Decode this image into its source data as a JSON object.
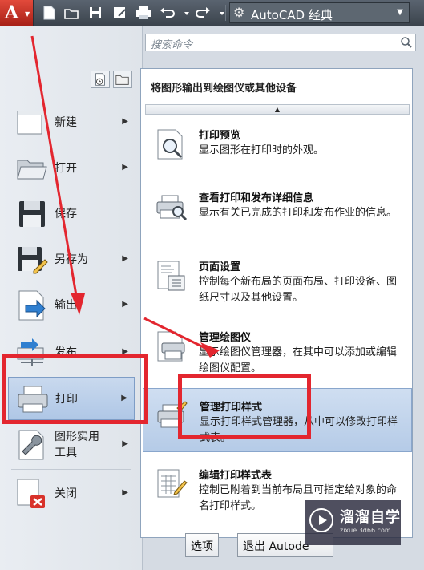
{
  "toolbar": {
    "workspace_label": "AutoCAD 经典"
  },
  "search": {
    "placeholder": "搜索命令"
  },
  "nav": {
    "items": [
      {
        "label": "新建",
        "icon": "new-document-icon"
      },
      {
        "label": "打开",
        "icon": "folder-open-icon"
      },
      {
        "label": "保存",
        "icon": "floppy-disk-icon"
      },
      {
        "label": "另存为",
        "icon": "save-as-icon"
      },
      {
        "label": "输出",
        "icon": "export-icon"
      },
      {
        "label": "发布",
        "icon": "publish-icon"
      },
      {
        "label": "打印",
        "icon": "printer-icon"
      },
      {
        "label": "图形实用工具",
        "label_line1": "图形实用",
        "label_line2": "工具",
        "icon": "wrench-icon"
      },
      {
        "label": "关闭",
        "icon": "close-document-icon"
      }
    ],
    "active": "打印"
  },
  "panel": {
    "header": "将图形输出到绘图仪或其他设备",
    "items": [
      {
        "title": "打印预览",
        "desc": "显示图形在打印时的外观。"
      },
      {
        "title": "查看打印和发布详细信息",
        "desc": "显示有关已完成的打印和发布作业的信息。"
      },
      {
        "title": "页面设置",
        "desc": "控制每个新布局的页面布局、打印设备、图纸尺寸以及其他设置。"
      },
      {
        "title": "管理绘图仪",
        "desc": "显示绘图仪管理器，在其中可以添加或编辑绘图仪配置。"
      },
      {
        "title": "管理打印样式",
        "desc": "显示打印样式管理器，从中可以修改打印样式表。"
      },
      {
        "title": "编辑打印样式表",
        "desc": "控制已附着到当前布局且可指定给对象的命名打印样式。"
      }
    ],
    "active": "管理打印样式"
  },
  "bottom": {
    "options_label": "选项",
    "exit_label": "退出 Autode"
  },
  "watermark": {
    "name": "溜溜自学",
    "url": "zixue.3d66.com"
  },
  "colors": {
    "accent": "#e3262f",
    "highlight": "#b5cbe7",
    "toolbar": "#3b434c"
  }
}
